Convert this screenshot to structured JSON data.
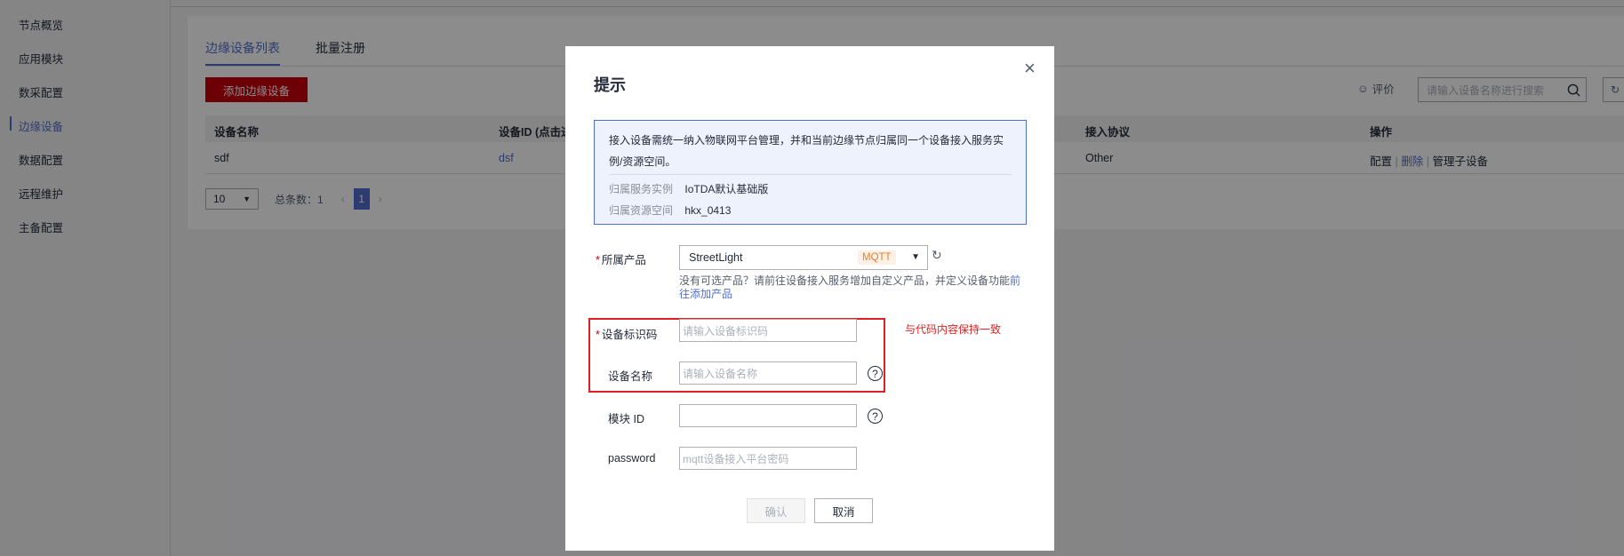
{
  "sidebar": {
    "items": [
      {
        "label": "节点概览"
      },
      {
        "label": "应用模块"
      },
      {
        "label": "数采配置"
      },
      {
        "label": "边缘设备"
      },
      {
        "label": "数据配置"
      },
      {
        "label": "远程维护"
      },
      {
        "label": "主备配置"
      }
    ],
    "active_index": 3
  },
  "tabs": [
    {
      "label": "边缘设备列表"
    },
    {
      "label": "批量注册"
    }
  ],
  "toolbar": {
    "add_button": "添加边缘设备",
    "rate_label": "评价",
    "search_placeholder": "请输入设备名称进行搜索"
  },
  "table": {
    "headers": [
      "设备名称",
      "设备ID (点击进",
      "接入协议",
      "操作"
    ],
    "rows": [
      {
        "name": "sdf",
        "id": "dsf",
        "protocol": "Other",
        "actions": [
          "配置",
          "删除",
          "管理子设备"
        ]
      }
    ]
  },
  "pagination": {
    "page_size": "10",
    "total_label": "总条数：1",
    "current_page": "1"
  },
  "modal": {
    "title": "提示",
    "info": {
      "text": "接入设备需统一纳入物联网平台管理，并和当前边缘节点归属同一个设备接入服务实例/资源空间。",
      "rows": [
        {
          "key": "归属服务实例",
          "value": "IoTDA默认基础版"
        },
        {
          "key": "归属资源空间",
          "value": "hkx_0413"
        }
      ]
    },
    "product": {
      "label": "所属产品",
      "value": "StreetLight",
      "tag": "MQTT",
      "hint": "没有可选产品？请前往设备接入服务增加自定义产品，并定义设备功能",
      "hint_link": "前往添加产品"
    },
    "device_id": {
      "label": "设备标识码",
      "placeholder": "请输入设备标识码"
    },
    "device_name": {
      "label": "设备名称",
      "placeholder": "请输入设备名称"
    },
    "module_id": {
      "label": "模块 ID",
      "placeholder": ""
    },
    "password": {
      "label": "password",
      "placeholder": "mqtt设备接入平台密码"
    },
    "annotation": "与代码内容保持一致",
    "confirm": "确认",
    "cancel": "取消"
  }
}
